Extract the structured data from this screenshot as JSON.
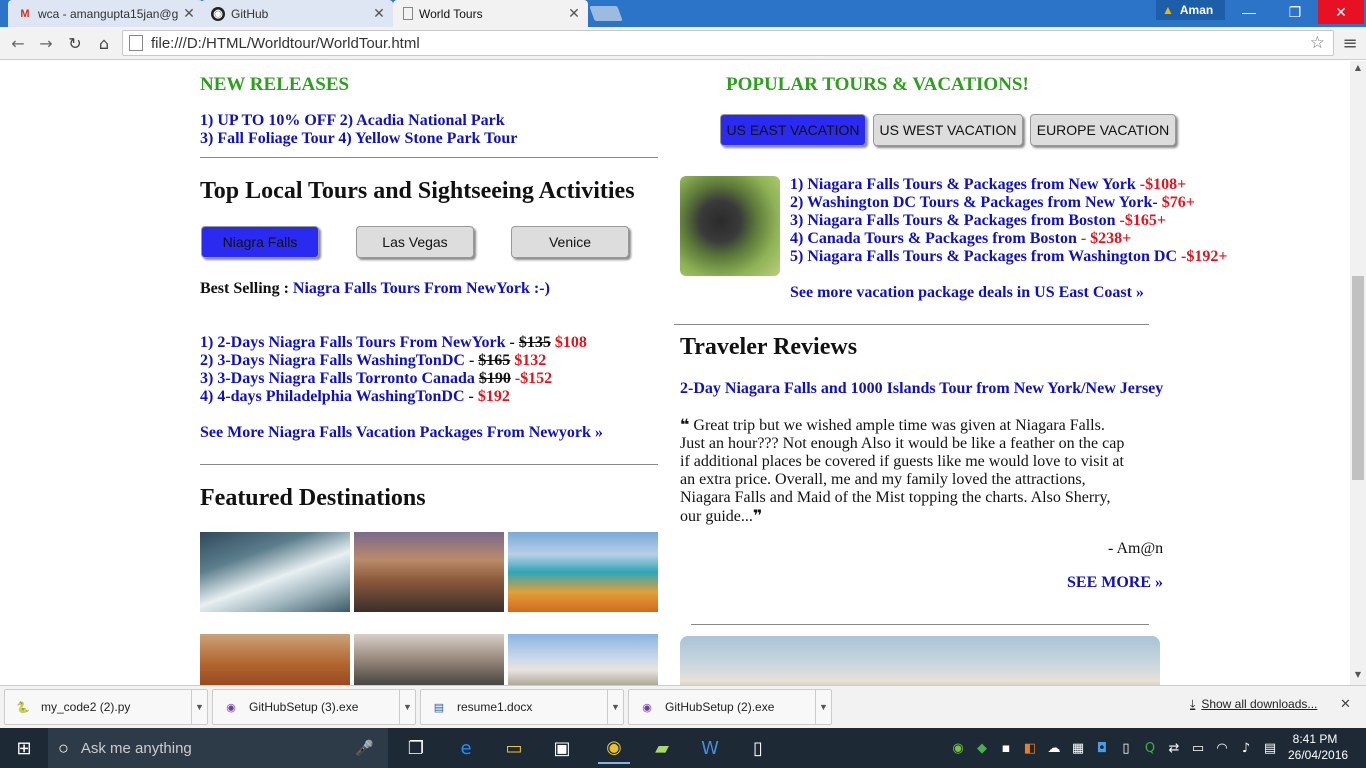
{
  "browser": {
    "tabs": [
      {
        "title": "wca - amangupta15jan@g",
        "icon": "gmail-icon"
      },
      {
        "title": "GitHub",
        "icon": "github-icon"
      },
      {
        "title": "World Tours",
        "icon": "page-icon"
      }
    ],
    "user": "Aman",
    "url": "file:///D:/HTML/Worldtour/WorldTour.html",
    "window_controls": {
      "minimize": "—",
      "restore": "❐",
      "close": "✕"
    }
  },
  "page": {
    "new_releases": {
      "heading": "NEW RELEASES",
      "line1": "1) UP TO 10% OFF 2) Acadia National Park",
      "line2": "3) Fall Foliage Tour 4) Yellow Stone Park Tour"
    },
    "top_local": {
      "heading": "Top Local Tours and Sightseeing Activities",
      "buttons": [
        "Niagra Falls",
        "Las Vegas",
        "Venice"
      ],
      "best_selling_label": "Best Selling :",
      "best_selling_link": "Niagra Falls Tours From NewYork :-)",
      "tours": [
        {
          "name": "1) 2-Days Niagra Falls Tours From NewYork",
          "sep": " - ",
          "old": "$135",
          "new": " $108"
        },
        {
          "name": "2) 3-Days Niagra Falls WashingTonDC",
          "sep": " - ",
          "old": "$165",
          "new": " $132"
        },
        {
          "name": "3) 3-Days Niagra Falls Torronto Canada",
          "sep": " ",
          "old": "$190",
          "new": " -$152"
        },
        {
          "name": "4) 4-days Philadelphia WashingTonDC",
          "sep": " - ",
          "old": "",
          "new": "$192"
        }
      ],
      "more_link": "See More Niagra Falls Vacation Packages From Newyork »"
    },
    "featured": {
      "heading": "Featured Destinations"
    },
    "popular": {
      "heading": "POPULAR TOURS & VACATIONS!",
      "buttons": [
        "US EAST VACATION",
        "US WEST VACATION",
        "EUROPE VACATION"
      ],
      "packages": [
        {
          "name": "1) Niagara Falls Tours & Packages from New York",
          "price": " -$108+"
        },
        {
          "name": "2) Washington DC Tours & Packages from New York-",
          "price": " $76+"
        },
        {
          "name": "3) Niagara Falls Tours & Packages from Boston",
          "price": " -$165+"
        },
        {
          "name": "4) Canada Tours & Packages from Boston",
          "price": " - $238+"
        },
        {
          "name": "5) Niagara Falls Tours & Packages from Washington DC",
          "price": " -$192+"
        }
      ],
      "more_link": "See more vacation package deals in US East Coast »"
    },
    "reviews": {
      "heading": "Traveler Reviews",
      "tour_link": "2-Day Niagara Falls and 1000 Islands Tour from New York/New Jersey",
      "text_lines": [
        "Great trip but we wished ample time was given at Niagara Falls.",
        "Just an hour??? Not enough Also it would be like a feather on the cap",
        "if additional places be covered if guests like me would love to visit at",
        "an extra price. Overall, me and my family loved the attractions,",
        "Niagara Falls and Maid of the Mist topping the charts. Also Sherry,",
        "our guide..."
      ],
      "open_quote": "❝",
      "close_quote": "❞",
      "author": "- Am@n",
      "see_more": "SEE MORE »"
    }
  },
  "downloads": {
    "items": [
      {
        "name": "my_code2 (2).py",
        "icon": "python-icon"
      },
      {
        "name": "GitHubSetup (3).exe",
        "icon": "installer-icon"
      },
      {
        "name": "resume1.docx",
        "icon": "word-icon"
      },
      {
        "name": "GitHubSetup (2).exe",
        "icon": "installer-icon"
      }
    ],
    "show_all": "Show all downloads..."
  },
  "taskbar": {
    "search_placeholder": "Ask me anything",
    "time": "8:41 PM",
    "date": "26/04/2016"
  },
  "colors": {
    "green_heading": "#2e9e1e",
    "link_blue": "#1111bb",
    "price_red": "#e0141e",
    "active_button": "#2a2af0"
  }
}
